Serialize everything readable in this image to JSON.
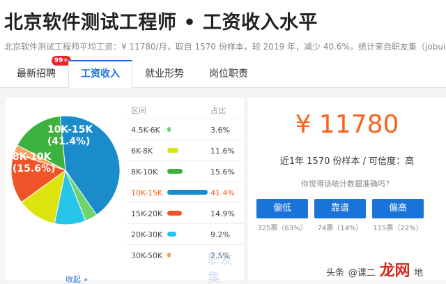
{
  "header": {
    "title": "北京软件测试工程师 • 工资收入水平",
    "subtitle": "北京软件测试工程师平均工资：¥ 11780/月，取自 1570 份样本，较 2019 年，减少 40.6%。统计来自职友集（jobui.com"
  },
  "tabs": [
    {
      "label": "最新招聘",
      "badge": "99+"
    },
    {
      "label": "工资收入"
    },
    {
      "label": "就业形势"
    },
    {
      "label": "岗位职责"
    }
  ],
  "table": {
    "col_range": "区间",
    "col_pct": "占比",
    "rows": [
      {
        "range": "4.5K-6K",
        "pct": "3.6%",
        "color": "#6dd36d",
        "value": 3.6
      },
      {
        "range": "6K-8K",
        "pct": "11.6%",
        "color": "#dde30e",
        "value": 11.6
      },
      {
        "range": "8K-10K",
        "pct": "15.6%",
        "color": "#3eb23e",
        "value": 15.6
      },
      {
        "range": "10K-15K",
        "pct": "41.4%",
        "color": "#1a8ccc",
        "value": 41.4
      },
      {
        "range": "15K-20K",
        "pct": "14.9%",
        "color": "#f0552a",
        "value": 14.9
      },
      {
        "range": "20K-30K",
        "pct": "9.2%",
        "color": "#27c6e8",
        "value": 9.2
      },
      {
        "range": "30K-50K",
        "pct": "2.5%",
        "color": "#f8a45a",
        "value": 2.5
      }
    ],
    "collapse": "收起 »",
    "watermark": "职友集"
  },
  "pie_labels": {
    "big_range": "10K-15K",
    "big_pct": "(41.4%)",
    "second_range": "8K-10K",
    "second_pct": "(15.6%)"
  },
  "summary": {
    "salary": "¥ 11780",
    "sample": "近1年 1570 份样本 / 可信度：高",
    "question": "你觉得该统计数据准确吗？",
    "buttons": [
      {
        "label": "偏低",
        "votes": "325票（63%）"
      },
      {
        "label": "靠谱",
        "votes": "74票（14%）"
      },
      {
        "label": "偏高",
        "votes": "115票（22%）"
      }
    ]
  },
  "brand": {
    "prefix": "头条",
    "mid": "@课二",
    "name": "龙网",
    "suffix": "地"
  },
  "chart_data": {
    "type": "pie",
    "categories": [
      "4.5K-6K",
      "6K-8K",
      "8K-10K",
      "10K-15K",
      "15K-20K",
      "20K-30K",
      "30K-50K"
    ],
    "values": [
      3.6,
      11.6,
      15.6,
      41.4,
      14.9,
      9.2,
      2.5
    ]
  }
}
